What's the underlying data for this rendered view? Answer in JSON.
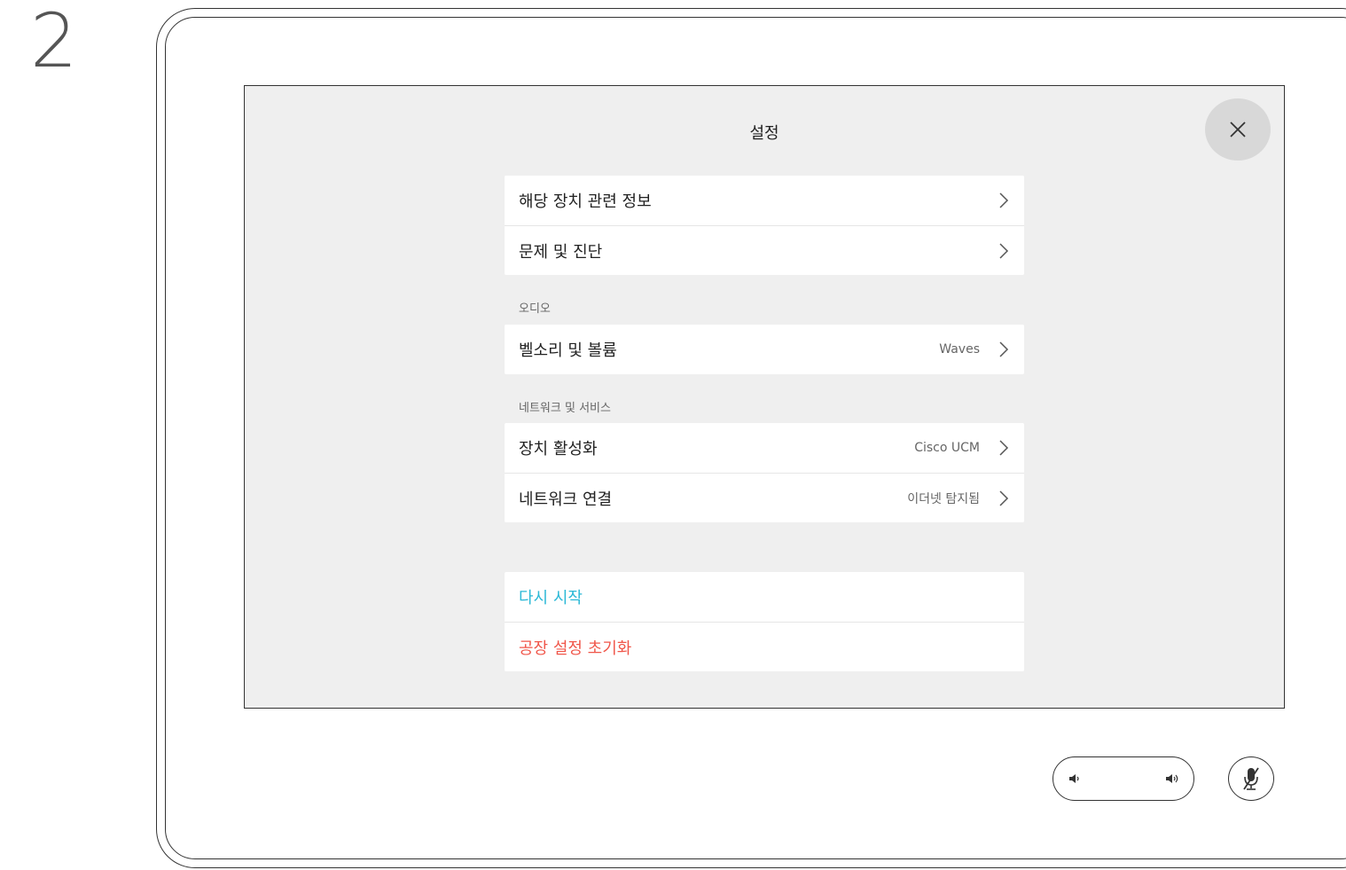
{
  "step_number": "2",
  "screen": {
    "title": "설정",
    "sections": [
      {
        "items": [
          {
            "label": "해당 장치 관련 정보",
            "value": ""
          },
          {
            "label": "문제 및 진단",
            "value": ""
          }
        ]
      },
      {
        "header": "오디오",
        "items": [
          {
            "label": "벨소리 및 볼륨",
            "value": "Waves"
          }
        ]
      },
      {
        "header": "네트워크 및 서비스",
        "items": [
          {
            "label": "장치 활성화",
            "value": "Cisco UCM"
          },
          {
            "label": "네트워크 연결",
            "value": "이더넷 탐지됨"
          }
        ]
      }
    ],
    "actions": {
      "restart_label": "다시 시작",
      "factory_reset_label": "공장 설정 초기화"
    }
  },
  "colors": {
    "restart": "#2bb8d6",
    "factory_reset": "#f0564a",
    "screen_bg": "#efefef"
  },
  "icons": {
    "close": "close-icon",
    "chevron": "chevron-right-icon",
    "volume_down": "volume-down-icon",
    "volume_up": "volume-up-icon",
    "mic_mute": "microphone-mute-icon"
  }
}
